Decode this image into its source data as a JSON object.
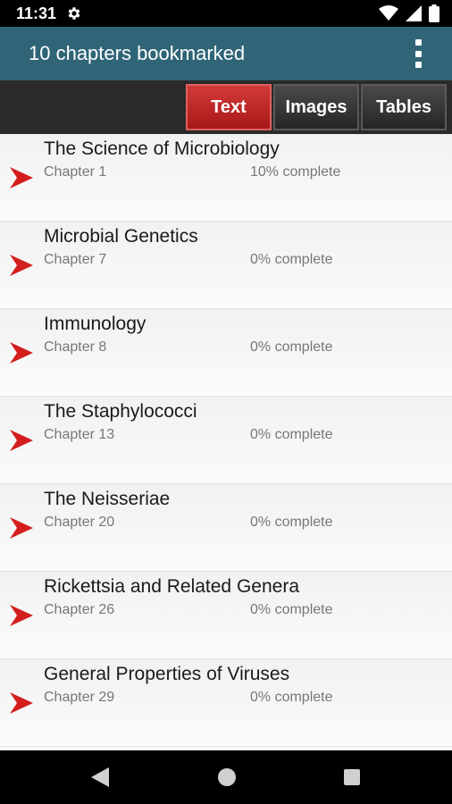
{
  "status_bar": {
    "time": "11:31"
  },
  "app_bar": {
    "title": "10 chapters bookmarked"
  },
  "tabs": [
    {
      "label": "Text",
      "selected": true
    },
    {
      "label": "Images",
      "selected": false
    },
    {
      "label": "Tables",
      "selected": false
    }
  ],
  "chapters": [
    {
      "title": "The Science of Microbiology",
      "chapter": "Chapter 1",
      "progress": "10% complete"
    },
    {
      "title": "Microbial Genetics",
      "chapter": "Chapter 7",
      "progress": "0% complete"
    },
    {
      "title": "Immunology",
      "chapter": "Chapter 8",
      "progress": "0% complete"
    },
    {
      "title": "The Staphylococci",
      "chapter": "Chapter 13",
      "progress": "0% complete"
    },
    {
      "title": "The Neisseriae",
      "chapter": "Chapter 20",
      "progress": "0% complete"
    },
    {
      "title": "Rickettsia and Related Genera",
      "chapter": "Chapter 26",
      "progress": "0% complete"
    },
    {
      "title": "General Properties of Viruses",
      "chapter": "Chapter 29",
      "progress": "0% complete"
    }
  ],
  "icons": {
    "settings": "gear-icon",
    "wifi": "wifi-icon",
    "signal": "cell-signal-icon",
    "battery": "battery-icon",
    "overflow": "more-vert-icon",
    "bookmark_arrow": "red-arrow-icon",
    "nav_back": "back-triangle-icon",
    "nav_home": "home-circle-icon",
    "nav_recents": "recents-square-icon"
  },
  "colors": {
    "app_bar": "#2f6577",
    "tab_selected": "#c02828",
    "tab_unselected": "#333333",
    "arrow": "#d41e1e"
  }
}
